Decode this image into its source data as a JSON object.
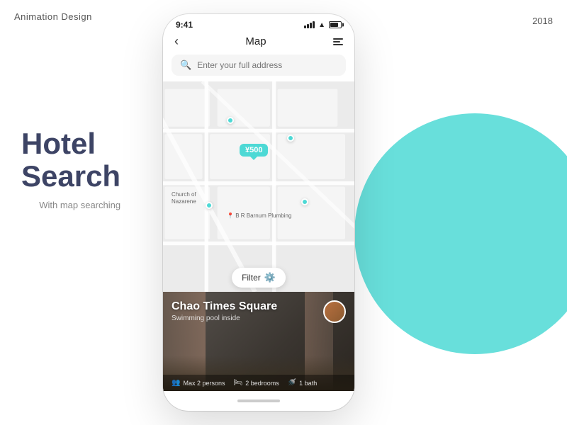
{
  "meta": {
    "brand": "Animation Design",
    "year": "2018"
  },
  "hero": {
    "title_line1": "Hotel",
    "title_line2": "Search",
    "subtitle": "With map searching"
  },
  "phone": {
    "status": {
      "time": "9:41",
      "signal": "●●●●",
      "wifi": "WiFi",
      "battery": "80"
    },
    "nav": {
      "back": "‹",
      "title": "Map",
      "menu": "≡"
    },
    "search": {
      "placeholder": "Enter your full address",
      "icon": "🔍"
    },
    "map": {
      "price_pin": "¥500",
      "label_church": "Church of\nNazarene",
      "label_plumbing": "B R Barnum Plumbing"
    },
    "filter": {
      "label": "Filter",
      "icon": "⚙"
    },
    "hotel": {
      "name": "Chao Times Square",
      "subtitle": "Swimming pool inside",
      "features": [
        {
          "icon": "👥",
          "text": "Max 2 persons"
        },
        {
          "icon": "🛏",
          "text": "2 bedrooms"
        },
        {
          "icon": "🚿",
          "text": "1 bath"
        }
      ]
    }
  }
}
